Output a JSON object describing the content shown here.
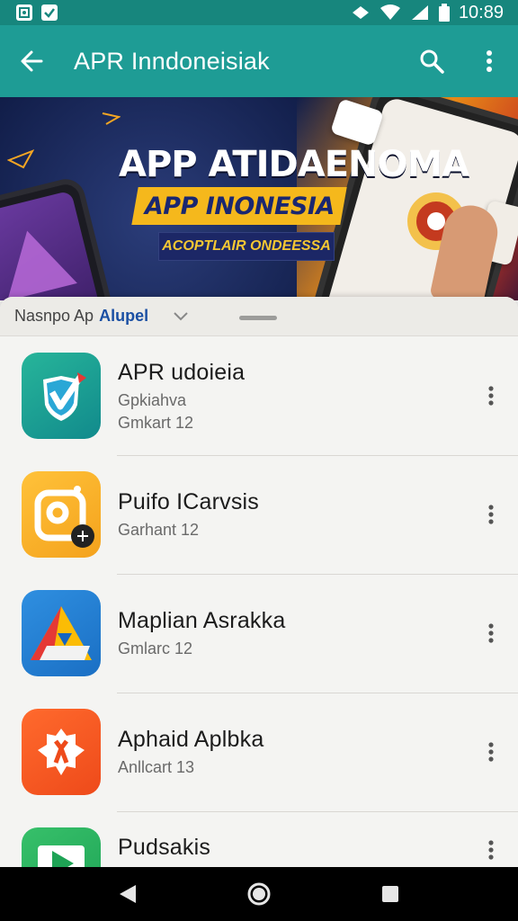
{
  "status_bar": {
    "time": "10:89",
    "icons": [
      "notification-icon",
      "check-icon",
      "vpn-key-icon",
      "wifi-icon",
      "signal-icon",
      "battery-icon"
    ]
  },
  "app_bar": {
    "title": "APR Inndoneisiak",
    "background": "#1e9c95",
    "icons": [
      "back-arrow-icon",
      "search-icon",
      "more-vert-icon"
    ]
  },
  "banner": {
    "title": "APP ATIDAENOMA",
    "ribbon": "APP INONESIA",
    "subtitle": "ACOPTLAIR ONDEESSA",
    "ribbon_color": "#f5b81c"
  },
  "sheet": {
    "label": "Nasnpo Ap",
    "accent_label": "Alupel",
    "accent_color": "#1a4fa3"
  },
  "apps": [
    {
      "name": "APR udoieia",
      "line1": "Gpkiahva",
      "line2": "Gmkart 12",
      "icon": "shield-check-icon"
    },
    {
      "name": "Puifo ICarvsis",
      "line1": "Garhant 12",
      "line2": "",
      "icon": "camera-plus-icon"
    },
    {
      "name": "Maplian Asrakka",
      "line1": "Gmlarc 12",
      "line2": "",
      "icon": "map-triangle-icon"
    },
    {
      "name": "Aphaid Aplbka",
      "line1": "Anllcart 13",
      "line2": "",
      "icon": "puzzle-gear-icon"
    },
    {
      "name": "Pudsakis",
      "line1": "",
      "line2": "",
      "icon": "play-icon"
    }
  ],
  "nav_bar": {
    "icons": [
      "nav-back-icon",
      "nav-home-icon",
      "nav-recents-icon"
    ]
  }
}
